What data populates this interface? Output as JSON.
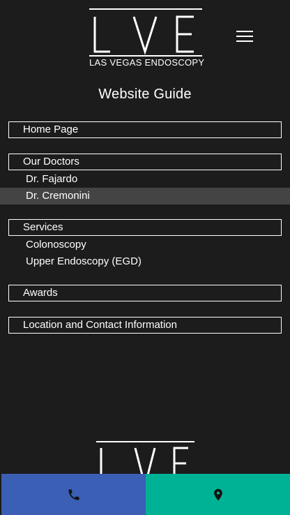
{
  "header": {
    "logo_letters": "LVE",
    "logo_subtitle": "LAS VEGAS ENDOSCOPY",
    "menu_icon": "hamburger-menu-icon"
  },
  "page_title": "Website Guide",
  "guide": {
    "home": "Home Page",
    "doctors": {
      "label": "Our Doctors",
      "items": [
        "Dr. Fajardo",
        "Dr. Cremonini"
      ],
      "active_item": "Dr. Cremonini"
    },
    "services": {
      "label": "Services",
      "items": [
        "Colonoscopy",
        "Upper Endoscopy (EGD)"
      ]
    },
    "awards": "Awards",
    "location": "Location and Contact Information"
  },
  "footer": {
    "logo_letters": "LVE"
  },
  "bottom_bar": {
    "call_icon": "phone-icon",
    "map_icon": "map-pin-icon"
  },
  "colors": {
    "background": "#1c1c1c",
    "call_button": "#3a5fb5",
    "map_button": "#00b295",
    "active_row": "#444444"
  }
}
